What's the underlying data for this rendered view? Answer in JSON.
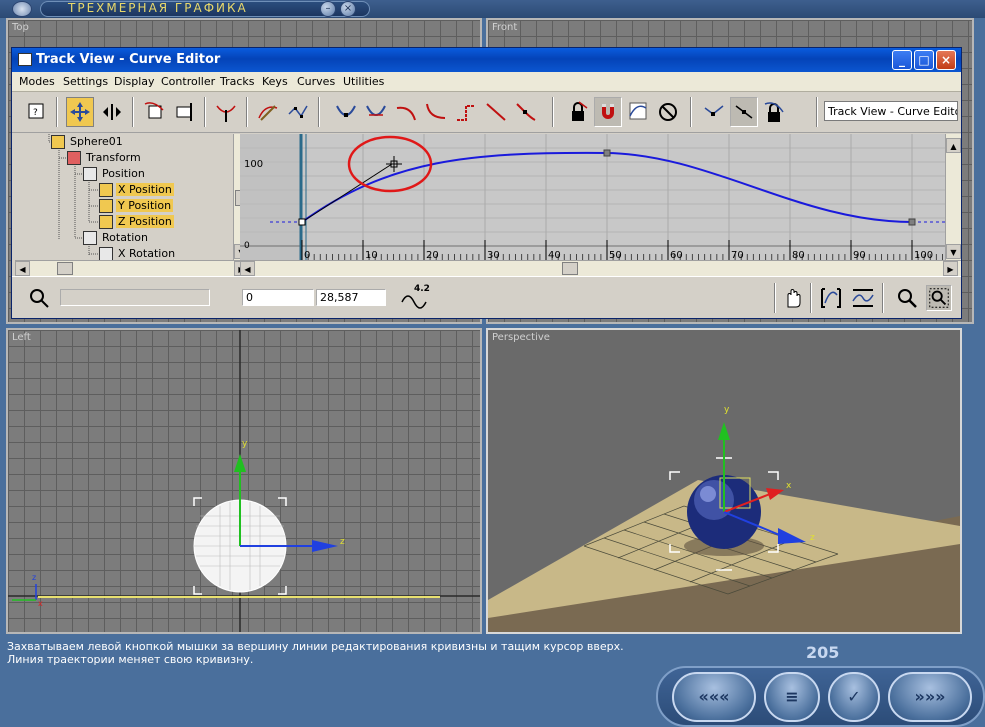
{
  "app": {
    "title": "ТРЕХМЕРНАЯ ГРАФИКА",
    "minimize_glyph": "–",
    "close_glyph": "×"
  },
  "viewports": {
    "top": "Top",
    "front": "Front",
    "left": "Left",
    "perspective": "Perspective"
  },
  "track_view": {
    "title": "Track View - Curve Editor",
    "window_buttons": {
      "minimize": "_",
      "maximize": "□",
      "close": "×"
    },
    "menus": [
      "Modes",
      "Settings",
      "Display",
      "Controller",
      "Tracks",
      "Keys",
      "Curves",
      "Utilities"
    ],
    "toolbar_title_field": "Track View - Curve Editor",
    "tree": [
      {
        "label": "Sphere01",
        "selected": false
      },
      {
        "label": "Transform",
        "selected": false
      },
      {
        "label": "Position",
        "selected": false
      },
      {
        "label": "X Position",
        "selected": true
      },
      {
        "label": "Y Position",
        "selected": true
      },
      {
        "label": "Z Position",
        "selected": true
      },
      {
        "label": "Rotation",
        "selected": false
      },
      {
        "label": "X Rotation",
        "selected": false
      }
    ],
    "curve": {
      "y_tick_label": "100",
      "y_zero_label": "0",
      "frame_ticks": [
        "0",
        "10",
        "20",
        "30",
        "40",
        "50",
        "60",
        "70",
        "80",
        "90",
        "100"
      ],
      "curve_color": "#1a1adc",
      "highlight_color": "#e01818"
    },
    "status": {
      "frame_value": "0",
      "value_field": "28,587",
      "curve_scale_label": "4.2"
    }
  },
  "caption": {
    "line1": "Захватываем левой кнопкой мышки за вершину линии редактирования кривизны и тащим курсор вверх.",
    "line2": "Линия траектории меняет свою кривизну."
  },
  "page_number": "205",
  "nav": {
    "back": "«««",
    "contents": "≡",
    "check": "✓",
    "forward": "»»»"
  }
}
